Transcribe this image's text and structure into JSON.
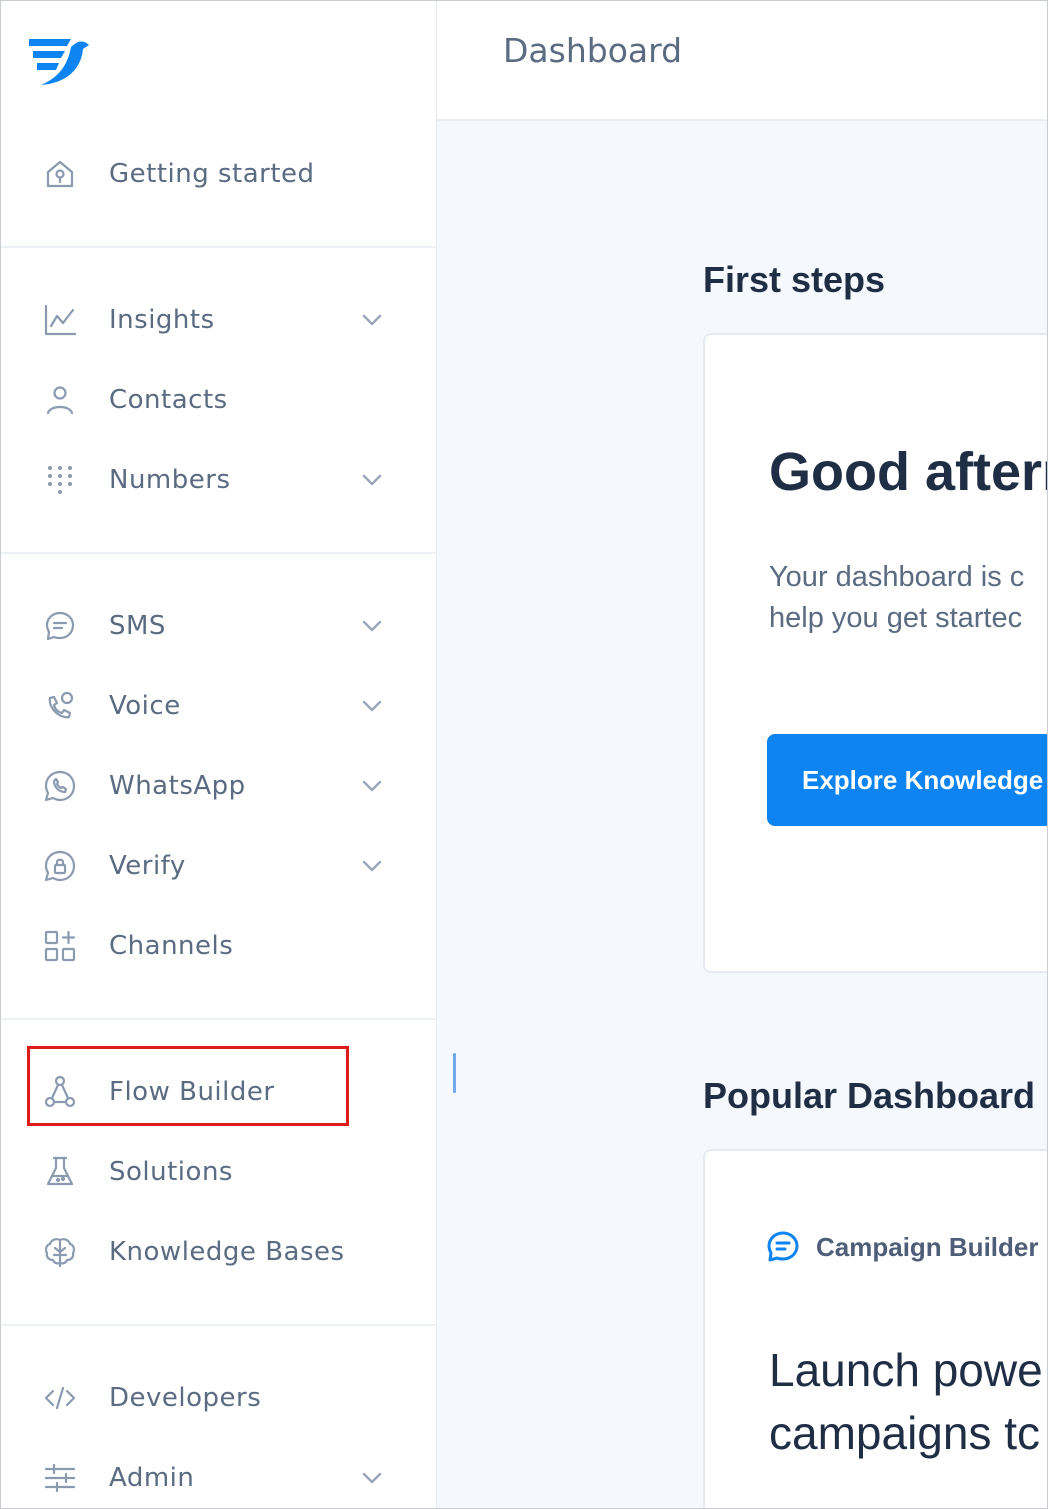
{
  "header": {
    "title": "Dashboard"
  },
  "sidebar": {
    "items": [
      {
        "id": "getting-started",
        "label": "Getting started",
        "icon": "home-icon",
        "chevron": false
      },
      {
        "id": "insights",
        "label": "Insights",
        "icon": "chart-line-icon",
        "chevron": true
      },
      {
        "id": "contacts",
        "label": "Contacts",
        "icon": "user-icon",
        "chevron": false
      },
      {
        "id": "numbers",
        "label": "Numbers",
        "icon": "keypad-icon",
        "chevron": true
      },
      {
        "id": "sms",
        "label": "SMS",
        "icon": "message-icon",
        "chevron": true
      },
      {
        "id": "voice",
        "label": "Voice",
        "icon": "phone-icon",
        "chevron": true
      },
      {
        "id": "whatsapp",
        "label": "WhatsApp",
        "icon": "whatsapp-icon",
        "chevron": true
      },
      {
        "id": "verify",
        "label": "Verify",
        "icon": "lock-icon",
        "chevron": true
      },
      {
        "id": "channels",
        "label": "Channels",
        "icon": "grid-plus-icon",
        "chevron": false
      },
      {
        "id": "flow-builder",
        "label": "Flow Builder",
        "icon": "flow-icon",
        "chevron": false
      },
      {
        "id": "solutions",
        "label": "Solutions",
        "icon": "flask-icon",
        "chevron": false
      },
      {
        "id": "knowledge-bases",
        "label": "Knowledge Bases",
        "icon": "brain-icon",
        "chevron": false
      },
      {
        "id": "developers",
        "label": "Developers",
        "icon": "code-icon",
        "chevron": false
      },
      {
        "id": "admin",
        "label": "Admin",
        "icon": "sliders-icon",
        "chevron": true
      }
    ]
  },
  "main": {
    "first_steps": {
      "title": "First steps",
      "greeting": "Good afterr",
      "description_lines": [
        "Your dashboard is c",
        "help you get startec"
      ],
      "button_label": "Explore Knowledge"
    },
    "popular": {
      "title": "Popular Dashboard",
      "tag_label": "Campaign Builder",
      "heading_lines": [
        "Launch powe",
        "campaigns tc"
      ]
    }
  },
  "colors": {
    "brand": "#0d84f2",
    "text_dark": "#1f2d45",
    "text_muted": "#5b6b82",
    "highlight": "#e01b1b"
  }
}
